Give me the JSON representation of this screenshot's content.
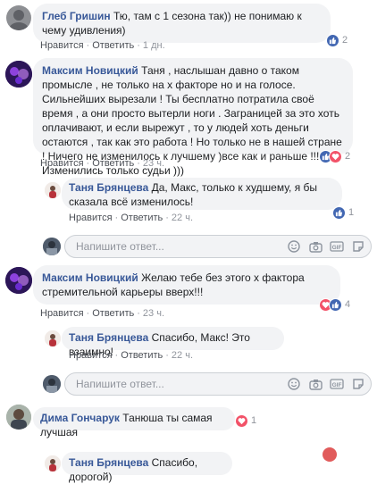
{
  "comments": [
    {
      "author": "Глеб Гришин",
      "text": "Тю, там с 1 сезона так)) не понимаю к чему удивления)",
      "like": "Нравится",
      "reply": "Ответить",
      "time": "1 дн.",
      "reactions": {
        "count": "2",
        "icons": [
          "like"
        ]
      }
    },
    {
      "author": "Максим Новицкий",
      "text": "Таня , наслышан давно о таком промысле , не только на х факторе но и на голосе. Сильнейших вырезали ! Ты бесплатно потратила своё время , а они просто вытерли ноги . Заграницей за это хоть оплачивают, и если вырежут , то у людей хоть деньги остаются , так как это работа ! Но только не в нашей стране ! Ничего не изменилось к лучшему )все как и раньше !!! Изменились только судьи )))",
      "like": "Нравится",
      "reply": "Ответить",
      "time": "23 ч.",
      "reactions": {
        "count": "2",
        "icons": [
          "like",
          "love"
        ]
      },
      "replies": [
        {
          "author": "Таня Брянцева",
          "text": "Да, Макс, только к худшему, я бы сказала всё изменилось!",
          "like": "Нравится",
          "reply": "Ответить",
          "time": "22 ч.",
          "reactions": {
            "count": "1",
            "icons": [
              "like"
            ]
          }
        }
      ],
      "reply_placeholder": "Напишите ответ..."
    },
    {
      "author": "Максим Новицкий",
      "text": "Желаю тебе без этого х фактора стремительной карьеры вверх!!!",
      "like": "Нравится",
      "reply": "Ответить",
      "time": "23 ч.",
      "reactions": {
        "count": "4",
        "icons": [
          "love",
          "like"
        ]
      },
      "replies": [
        {
          "author": "Таня Брянцева",
          "text": "Спасибо, Макс! Это взаимно!",
          "like": "Нравится",
          "reply": "Ответить",
          "time": "22 ч."
        }
      ],
      "reply_placeholder": "Напишите ответ..."
    },
    {
      "author": "Дима Гончарук",
      "text": "Танюша ты самая лучшая",
      "reactions": {
        "count": "1",
        "icons": [
          "love"
        ]
      },
      "replies": [
        {
          "author": "Таня Брянцева",
          "text": "Спасибо, дорогой)"
        }
      ]
    }
  ],
  "composer_tools": [
    "emoji-icon",
    "camera-icon",
    "gif-icon",
    "sticker-icon"
  ],
  "colors": {
    "author": "#385898",
    "bubble": "#f2f3f5",
    "like": "#4267b2",
    "love": "#f25268",
    "meta": "#90949c",
    "record_dot": "#e15b5b"
  }
}
